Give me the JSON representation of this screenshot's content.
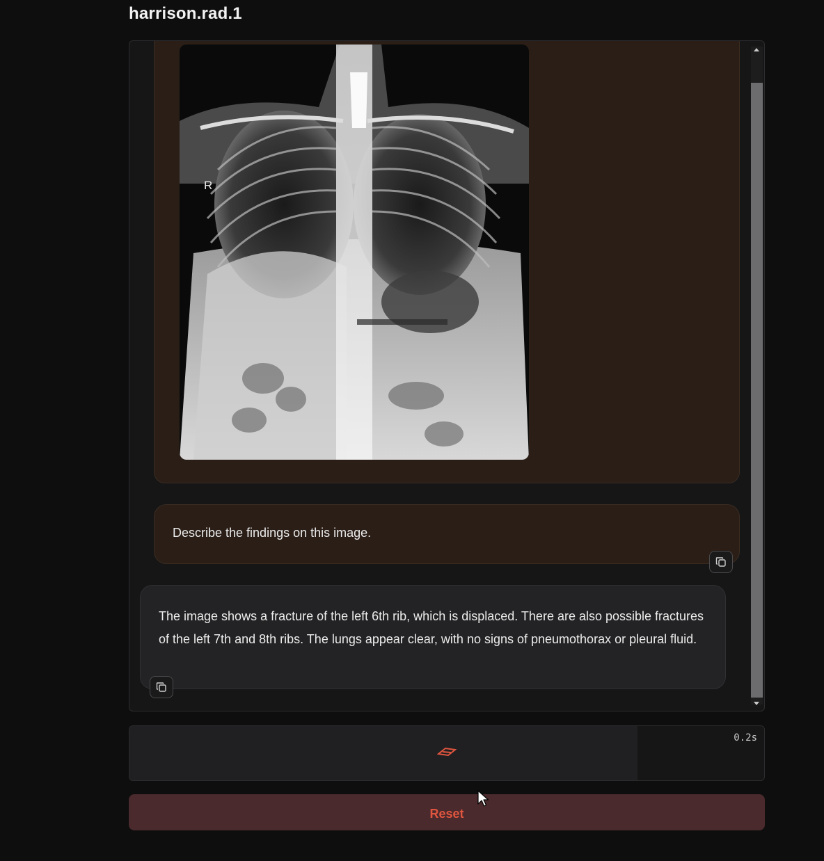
{
  "app": {
    "title": "harrison.rad.1"
  },
  "chat": {
    "image_message": {
      "alt": "chest x-ray image",
      "marker_label": "R"
    },
    "user_message": "Describe the findings on this image.",
    "bot_message": "The image shows a fracture of the left 6th rib, which is displaced. There are also possible fractures of the left 7th and 8th ribs. The lungs appear clear, with no signs of pneumothorax or pleural fluid."
  },
  "status": {
    "timer": "0.2s",
    "progress_fraction": 0.8
  },
  "controls": {
    "reset_label": "Reset"
  },
  "icons": {
    "copy": "copy-icon",
    "loader": "loading-icon",
    "cursor": "mouse-pointer-icon",
    "scroll_up": "scroll-up-arrow-icon",
    "scroll_down": "scroll-down-arrow-icon"
  },
  "colors": {
    "background": "#0e0e0f",
    "panel": "#161617",
    "user_bubble": "#2a1e17",
    "bot_bubble": "#232325",
    "reset_bg": "#4a2a2c",
    "accent": "#e0553f"
  }
}
